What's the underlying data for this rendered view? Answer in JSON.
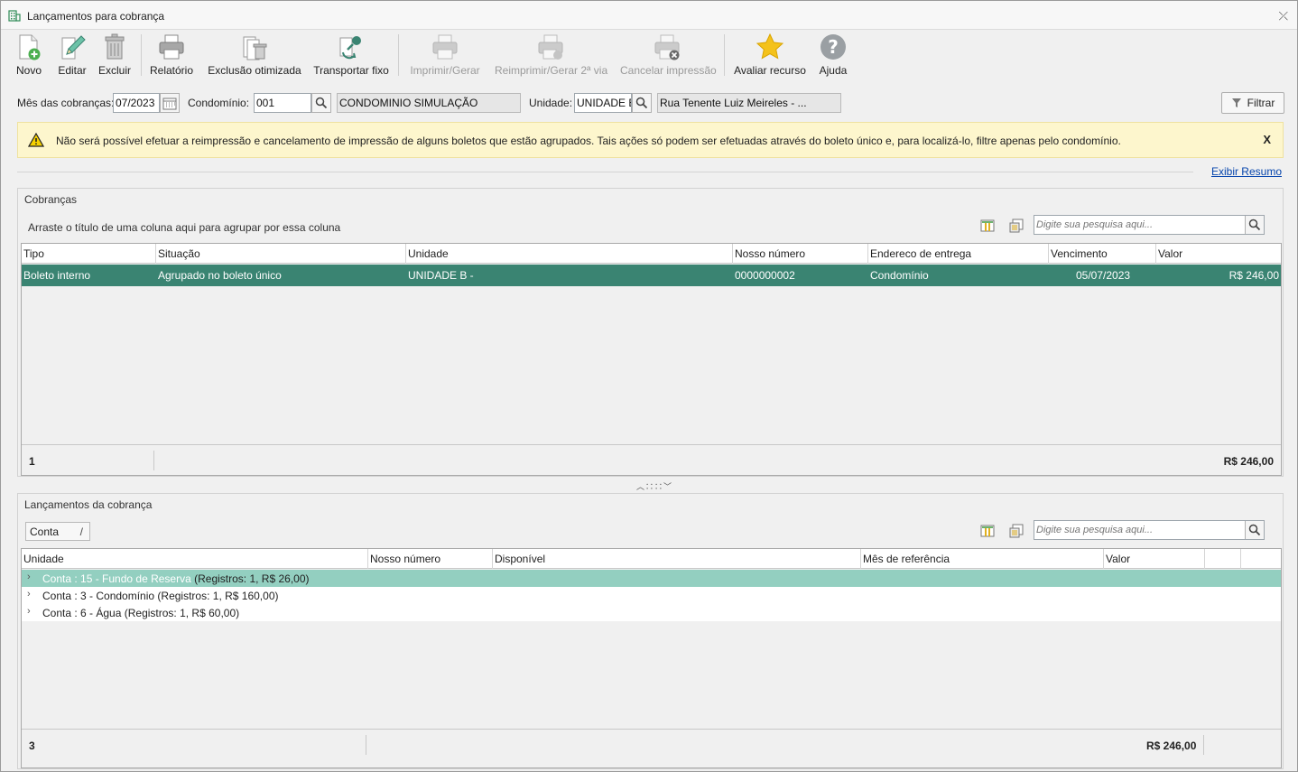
{
  "window": {
    "title": "Lançamentos para cobrança",
    "close": "⤫"
  },
  "toolbar": {
    "novo": "Novo",
    "editar": "Editar",
    "excluir": "Excluir",
    "relatorio": "Relatório",
    "exclusao": "Exclusão otimizada",
    "transportar": "Transportar fixo",
    "imprimir": "Imprimir/Gerar",
    "reimprimir": "Reimprimir/Gerar 2ª via",
    "cancelar": "Cancelar impressão",
    "avaliar": "Avaliar recurso",
    "ajuda": "Ajuda"
  },
  "filters": {
    "mes_label": "Mês das cobranças:",
    "mes_value": "07/2023",
    "condominio_label": "Condomínio:",
    "condominio_code": "001",
    "condominio_name": "CONDOMINIO SIMULAÇÃO",
    "unidade_label": "Unidade:",
    "unidade_value": "UNIDADE B",
    "unidade_address": "Rua Tenente Luiz Meireles - ...",
    "filtrar": "Filtrar"
  },
  "warning": {
    "text": "Não será possível efetuar a reimpressão e cancelamento de impressão de alguns boletos que estão agrupados. Tais ações só podem ser efetuadas através do boleto único e, para localizá-lo, filtre apenas pelo condomínio.",
    "close": "X"
  },
  "exibir_resumo": "Exibir Resumo",
  "cobrancas": {
    "title": "Cobranças",
    "group_hint": "Arraste o título de uma coluna aqui para agrupar por essa coluna",
    "search_placeholder": "Digite sua pesquisa aqui...",
    "columns": [
      "Tipo",
      "Situação",
      "Unidade",
      "Nosso número",
      "Endereco de entrega",
      "Vencimento",
      "Valor"
    ],
    "rows": [
      {
        "tipo": "Boleto interno",
        "situacao": "Agrupado no boleto único",
        "unidade": "UNIDADE B -",
        "nosso_numero": "0000000002",
        "endereco": "Condomínio",
        "vencimento": "05/07/2023",
        "valor": "R$ 246,00"
      }
    ],
    "footer_count": "1",
    "footer_total": "R$ 246,00"
  },
  "lancamentos": {
    "title": "Lançamentos da cobrança",
    "group_tag": "Conta",
    "group_tag_sep": "/",
    "search_placeholder": "Digite sua pesquisa aqui...",
    "columns": [
      "Unidade",
      "Nosso número",
      "Disponível",
      "Mês de referência",
      "Valor"
    ],
    "groups": [
      {
        "label": "Conta : 15 - Fundo  de Reserva",
        "summary": "(Registros: 1, R$ 26,00)"
      },
      {
        "label": "Conta : 3 - Condomínio",
        "summary": "(Registros: 1, R$ 160,00)"
      },
      {
        "label": "Conta : 6 - Água",
        "summary": "(Registros: 1, R$ 60,00)"
      }
    ],
    "footer_count": "3",
    "footer_total": "R$ 246,00"
  },
  "colors": {
    "selected_row": "#3a8472",
    "selected_group": "#93cfc0",
    "warning_bg": "#fdf6cd",
    "link": "#0645ad"
  }
}
